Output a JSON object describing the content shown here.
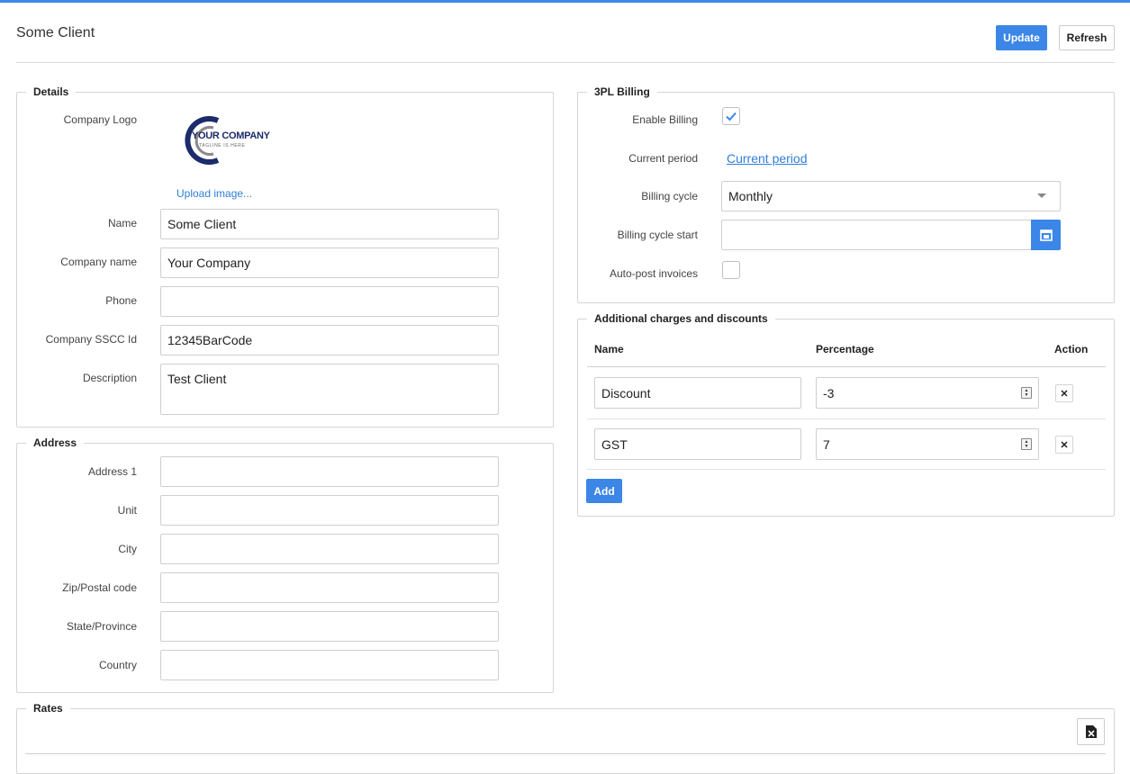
{
  "header": {
    "title": "Some Client",
    "update_label": "Update",
    "refresh_label": "Refresh"
  },
  "details": {
    "legend": "Details",
    "logo_label": "Company Logo",
    "logo_text": "YOUR COMPANY",
    "logo_tagline": "TAGLINE IS HERE",
    "upload_label": "Upload image...",
    "fields": [
      {
        "label": "Name",
        "value": "Some Client"
      },
      {
        "label": "Company name",
        "value": "Your Company"
      },
      {
        "label": "Phone",
        "value": ""
      },
      {
        "label": "Company SSCC Id",
        "value": "12345BarCode"
      },
      {
        "label": "Description",
        "value": "Test Client"
      }
    ]
  },
  "address": {
    "legend": "Address",
    "fields": [
      {
        "label": "Address 1",
        "value": ""
      },
      {
        "label": "Unit",
        "value": ""
      },
      {
        "label": "City",
        "value": ""
      },
      {
        "label": "Zip/Postal code",
        "value": ""
      },
      {
        "label": "State/Province",
        "value": ""
      },
      {
        "label": "Country",
        "value": ""
      }
    ]
  },
  "billing": {
    "legend": "3PL Billing",
    "enable_label": "Enable Billing",
    "enable_checked": true,
    "current_period_label": "Current period",
    "current_period_link": "Current period",
    "cycle_label": "Billing cycle",
    "cycle_value": "Monthly",
    "cycle_start_label": "Billing cycle start",
    "cycle_start_value": "",
    "autopost_label": "Auto-post invoices",
    "autopost_checked": false
  },
  "charges": {
    "legend": "Additional charges and discounts",
    "columns": {
      "name": "Name",
      "percentage": "Percentage",
      "action": "Action"
    },
    "rows": [
      {
        "name": "Discount",
        "percentage": "-3"
      },
      {
        "name": "GST",
        "percentage": "7"
      }
    ],
    "add_label": "Add"
  },
  "rates": {
    "legend": "Rates"
  },
  "colors": {
    "accent": "#3b86e6",
    "logo_navy": "#1c2b6b"
  },
  "icons": [
    "check-icon",
    "calendar-icon",
    "dropdown-caret-icon",
    "close-icon",
    "spinner-icon",
    "excel-export-icon"
  ]
}
